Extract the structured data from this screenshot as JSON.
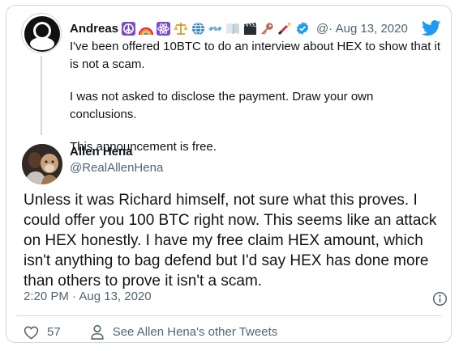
{
  "quoted_tweet": {
    "author_name": "Andreas",
    "emoji_badges": [
      "peace-icon",
      "rainbow-icon",
      "atom-icon",
      "scales-icon",
      "globe-icon",
      "satellite-icon",
      "book-icon",
      "clapperboard-icon",
      "key-icon",
      "fireworks-icon"
    ],
    "verified_icon": "verified-badge-icon",
    "handle": "@· Aug 13, 2020",
    "paragraphs": [
      "I've been offered 10BTC to do an interview about HEX to show that it is not a scam.",
      "I was not asked to disclose the payment. Draw your own conclusions.",
      "This announcement is free."
    ],
    "brand_icon": "twitter-bird-icon",
    "brand_color": "#1d9bf0"
  },
  "reply_tweet": {
    "author_name": "Allen Hena",
    "handle": "@RealAllenHena",
    "text": "Unless it was Richard himself, not sure what this proves. I could offer you 100 BTC right now. This seems like an attack on HEX honestly. I have my free claim HEX amount, which isn't anything to bag defend but I'd say HEX has done more than others to prove it isn't a scam.",
    "timestamp": "2:20 PM · Aug 13, 2020",
    "likes": "57",
    "profile_link": "See Allen Hena's other Tweets"
  }
}
